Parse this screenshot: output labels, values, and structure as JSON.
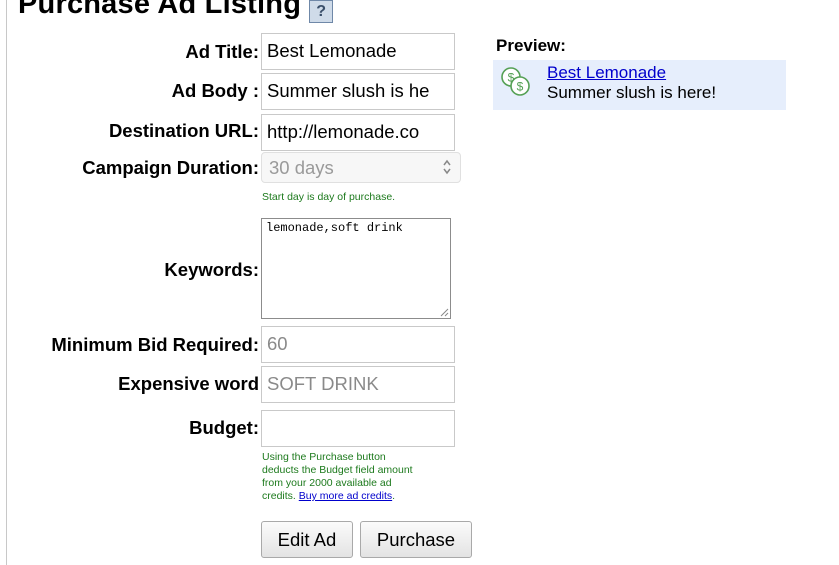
{
  "header": {
    "title": "Purchase Ad Listing",
    "help_label": "?"
  },
  "form": {
    "ad_title": {
      "label": "Ad Title:",
      "value": "Best Lemonade"
    },
    "ad_body": {
      "label": "Ad Body :",
      "value": "Summer slush is he"
    },
    "destination_url": {
      "label": "Destination URL:",
      "value": "http://lemonade.co"
    },
    "campaign_duration": {
      "label": "Campaign Duration:",
      "value": "30 days",
      "hint": "Start day is day of purchase."
    },
    "keywords": {
      "label": "Keywords:",
      "value": "lemonade,soft drink"
    },
    "min_bid": {
      "label": "Minimum Bid Required:",
      "value": "60"
    },
    "expensive_word": {
      "label": "Expensive word",
      "value": "SOFT DRINK"
    },
    "budget": {
      "label": "Budget:",
      "value": "",
      "hint_lines": [
        "Using the Purchase button",
        "deducts the Budget field amount",
        "from your 2000 available ad",
        "credits."
      ],
      "buy_link": "Buy more ad credits",
      "hint_end": "."
    },
    "edit_button": "Edit Ad",
    "purchase_button": "Purchase"
  },
  "preview": {
    "label": "Preview:",
    "icon": "coins-icon",
    "title": "Best Lemonade",
    "body": "Summer slush is here!",
    "bg_color": "#e6eefc",
    "link_color": "#0000cc"
  },
  "colors": {
    "hint": "#1d7a1d",
    "link": "#0000cc"
  }
}
